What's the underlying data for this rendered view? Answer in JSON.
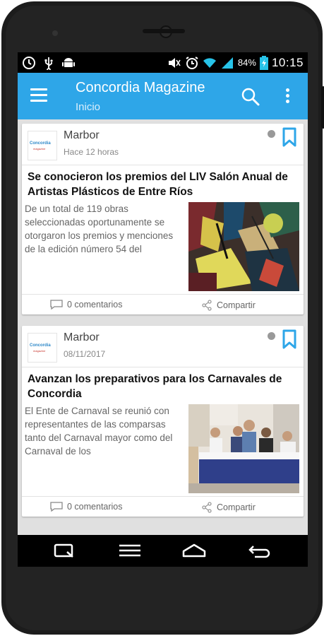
{
  "colors": {
    "accent": "#2ea6e8",
    "bookmark": "#2ea6e8"
  },
  "status_bar": {
    "left_icons": [
      "clock-alarm-icon",
      "usb-icon",
      "android-debug-icon"
    ],
    "right_icons": [
      "volume-mute-icon",
      "alarm-icon",
      "wifi-icon",
      "signal-icon",
      "battery-icon"
    ],
    "battery": "84%",
    "time": "10:15"
  },
  "app_bar": {
    "title": "Concordia Magazine",
    "subtitle": "Inicio",
    "icons": [
      "menu-icon",
      "search-icon",
      "more-vert-icon"
    ]
  },
  "posts": [
    {
      "author": "Marbor",
      "date": "Hace 12 horas",
      "title": "Se conocieron los premios del LIV Salón Anual de Artistas Plásticos de Entre Ríos",
      "excerpt": "De un total de 119 obras seleccionadas oportunamente se otorgaron los premios y menciones de la edición número 54 del",
      "comments": "0 comentarios",
      "share": "Compartir"
    },
    {
      "author": "Marbor",
      "date": "08/11/2017",
      "title": "Avanzan los preparativos para los Carnavales de Concordia",
      "excerpt": "El Ente de Carnaval se reunió con representantes de las comparsas tanto del Carnaval mayor como del Carnaval de los",
      "comments": "0 comentarios",
      "share": "Compartir"
    }
  ],
  "nav_bar": {
    "icons": [
      "recents-icon",
      "menu-icon",
      "home-icon",
      "back-icon"
    ]
  }
}
